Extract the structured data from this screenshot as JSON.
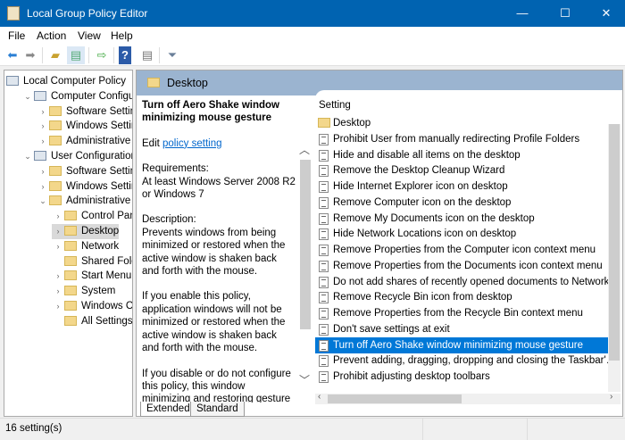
{
  "window": {
    "title": "Local Group Policy Editor",
    "minimize": "—",
    "maximize": "☐",
    "close": "✕"
  },
  "menu": [
    "File",
    "Action",
    "View",
    "Help"
  ],
  "toolbar": [
    "back-icon",
    "forward-icon",
    "up-folder-icon",
    "show-hide-tree-icon",
    "export-icon",
    "help-icon",
    "properties-icon",
    "filter-icon"
  ],
  "tree": [
    {
      "label": "Local Computer Policy",
      "level": 0,
      "chev": ""
    },
    {
      "label": "Computer Configurati",
      "level": 1,
      "chev": "v"
    },
    {
      "label": "Software Settings",
      "level": 2,
      "chev": ">"
    },
    {
      "label": "Windows Settings",
      "level": 2,
      "chev": ">"
    },
    {
      "label": "Administrative Te",
      "level": 2,
      "chev": ">"
    },
    {
      "label": "User Configuration",
      "level": 1,
      "chev": "v"
    },
    {
      "label": "Software Settings",
      "level": 2,
      "chev": ">"
    },
    {
      "label": "Windows Settings",
      "level": 2,
      "chev": ">"
    },
    {
      "label": "Administrative Te",
      "level": 2,
      "chev": "v"
    },
    {
      "label": "Control Panel",
      "level": 3,
      "chev": ">"
    },
    {
      "label": "Desktop",
      "level": 3,
      "chev": ">",
      "selected": true
    },
    {
      "label": "Network",
      "level": 3,
      "chev": ">"
    },
    {
      "label": "Shared Folders",
      "level": 3,
      "chev": ""
    },
    {
      "label": "Start Menu and",
      "level": 3,
      "chev": ">"
    },
    {
      "label": "System",
      "level": 3,
      "chev": ">"
    },
    {
      "label": "Windows Compon",
      "level": 3,
      "chev": ">"
    },
    {
      "label": "All Settings",
      "level": 3,
      "chev": ""
    }
  ],
  "header": {
    "title": "Desktop"
  },
  "description": {
    "title": "Turn off Aero Shake window minimizing mouse gesture",
    "edit_prefix": "Edit ",
    "edit_link": "policy setting",
    "requirements": "Requirements:\nAt least Windows Server 2008 R2 or Windows 7",
    "description": "Description:\nPrevents windows from being minimized or restored when the active window is shaken back and forth with the mouse.",
    "enable": "If you enable this policy, application windows will not be minimized or restored when the active window is shaken back and forth with the mouse.",
    "disable": "If you disable or do not configure this policy, this window minimizing and restoring gesture"
  },
  "list": {
    "column": "Setting",
    "items": [
      "Desktop",
      "Prohibit User from manually redirecting Profile Folders",
      "Hide and disable all items on the desktop",
      "Remove the Desktop Cleanup Wizard",
      "Hide Internet Explorer icon on desktop",
      "Remove Computer icon on the desktop",
      "Remove My Documents icon on the desktop",
      "Hide Network Locations icon on desktop",
      "Remove Properties from the Computer icon context menu",
      "Remove Properties from the Documents icon context menu",
      "Do not add shares of recently opened documents to Network…",
      "Remove Recycle Bin icon from desktop",
      "Remove Properties from the Recycle Bin context menu",
      "Don't save settings at exit",
      "Turn off Aero Shake window minimizing mouse gesture",
      "Prevent adding, dragging, dropping and closing the Taskbar'…",
      "Prohibit adjusting desktop toolbars"
    ],
    "selected_index": 14
  },
  "tabs": [
    "Extended",
    "Standard"
  ],
  "status": "16 setting(s)"
}
